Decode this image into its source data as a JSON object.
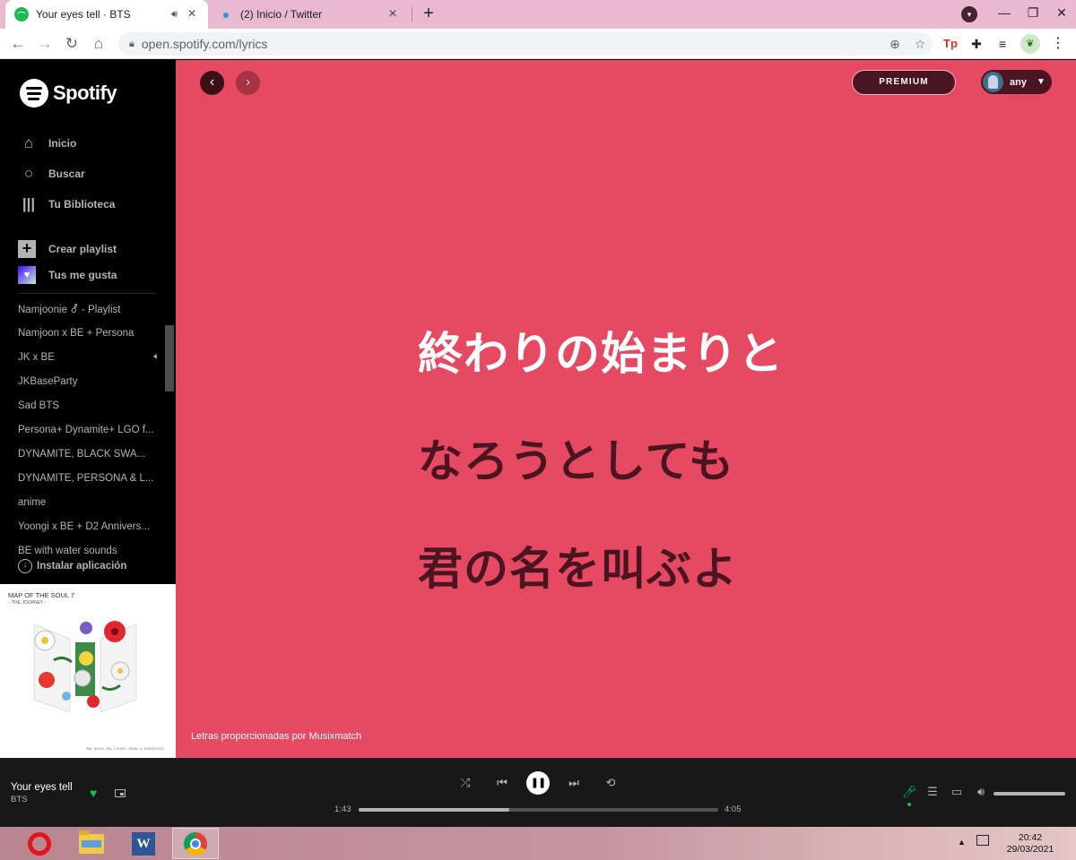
{
  "browser": {
    "tabs": [
      {
        "title": "Your eyes tell · BTS",
        "active": true,
        "audio": true
      },
      {
        "title": "(2) Inicio / Twitter",
        "active": false
      }
    ],
    "url": "open.spotify.com/lyrics",
    "extensions": {
      "tp_label": "Tp"
    }
  },
  "sidebar": {
    "brand": "Spotify",
    "nav": [
      {
        "label": "Inicio",
        "icon": "home-icon"
      },
      {
        "label": "Buscar",
        "icon": "search-icon"
      },
      {
        "label": "Tu Biblioteca",
        "icon": "library-icon"
      }
    ],
    "create_playlist": "Crear playlist",
    "liked_songs": "Tus me gusta",
    "playlists": [
      "Namjoonie ⚦ - Playlist",
      "Namjoon x BE + Persona",
      "JK x BE",
      "JKBaseParty",
      "Sad BTS",
      "Persona+ Dynamite+ LGO f...",
      "DYNAMITE, BLACK SWA...",
      "DYNAMITE, PERSONA & L...",
      "anime",
      "Yoongi x BE + D2 Annivers...",
      "BE with water sounds"
    ],
    "playing_playlist_index": 2,
    "install_app": "Instalar aplicación",
    "cover": {
      "title": "MAP OF THE SOUL 7",
      "subtitle": "- THE JOURNEY -",
      "credits": "RM, SUGA, JIN, J-HOPE, JIMIN, V, JUNGKOOK"
    }
  },
  "header": {
    "premium_label": "PREMIUM",
    "user_name": "any"
  },
  "lyrics": {
    "lines": [
      "終わりの始まりと",
      "なろうとしても",
      "君の名を叫ぶよ"
    ],
    "current_index": 0,
    "credits": "Letras proporcionadas por Musixmatch",
    "colors": {
      "background": "#e64a62",
      "active": "#ffffff",
      "inactive": "#4a1420"
    }
  },
  "player": {
    "track_title": "Your eyes tell",
    "artist": "BTS",
    "liked": true,
    "elapsed": "1:43",
    "duration": "4:05",
    "progress_fraction": 0.42,
    "volume_fraction": 1.0,
    "state": "playing"
  },
  "taskbar": {
    "apps": [
      "opera-icon",
      "file-explorer-icon",
      "word-icon",
      "chrome-icon"
    ],
    "time": "20:42",
    "date": "29/03/2021"
  }
}
